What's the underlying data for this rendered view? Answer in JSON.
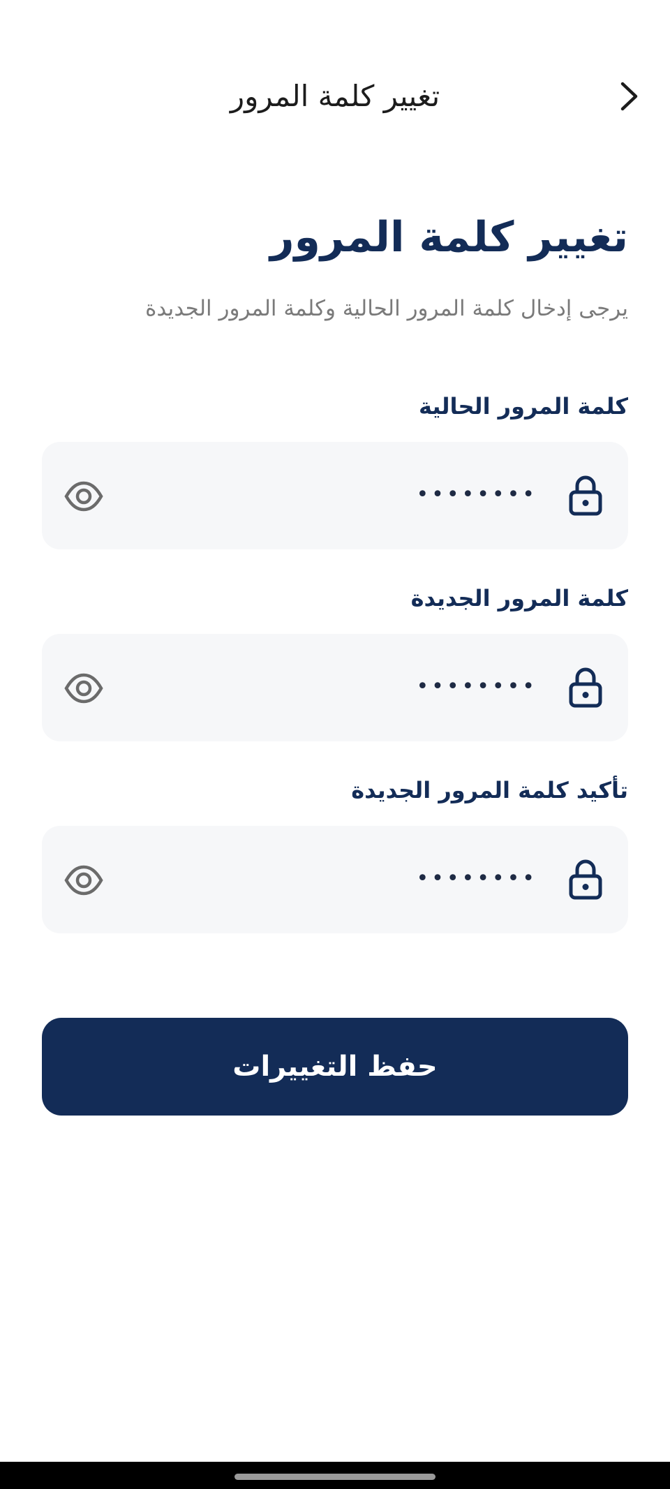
{
  "appbar": {
    "title": "تغيير كلمة المرور",
    "back_icon": "chevron-right-icon"
  },
  "main": {
    "heading": "تغيير كلمة المرور",
    "subtitle": "يرجى إدخال كلمة المرور الحالية وكلمة المرور الجديدة",
    "fields": [
      {
        "label": "كلمة المرور الحالية",
        "value": "••••••••",
        "leading_icon": "lock-icon",
        "toggle_icon": "eye-icon"
      },
      {
        "label": "كلمة المرور الجديدة",
        "value": "••••••••",
        "leading_icon": "lock-icon",
        "toggle_icon": "eye-icon"
      },
      {
        "label": "تأكيد كلمة المرور الجديدة",
        "value": "••••••••",
        "leading_icon": "lock-icon",
        "toggle_icon": "eye-icon"
      }
    ],
    "save_label": "حفظ التغييرات"
  },
  "colors": {
    "primary": "#132c57",
    "field_bg": "#f6f7f9",
    "subtitle": "#7a7a7a",
    "icon_gray": "#6b6b6b"
  }
}
